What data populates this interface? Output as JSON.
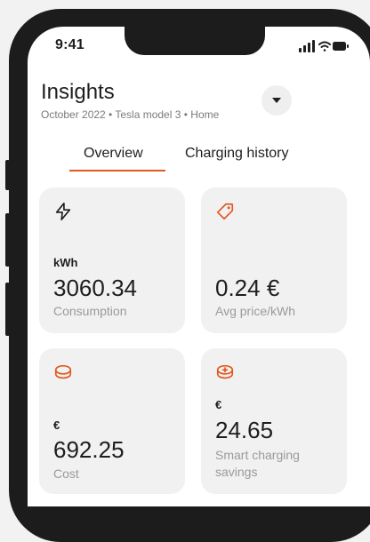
{
  "status_bar": {
    "time": "9:41"
  },
  "header": {
    "title": "Insights",
    "subtitle": "October 2022 • Tesla model 3 • Home"
  },
  "tabs": [
    {
      "label": "Overview"
    },
    {
      "label": "Charging history"
    }
  ],
  "cards": [
    {
      "icon": "lightning-icon",
      "unit": "kWh",
      "value": "3060.34",
      "label": "Consumption"
    },
    {
      "icon": "price-tag-icon",
      "unit": "",
      "value": "0.24 €",
      "label": "Avg price/kWh"
    },
    {
      "icon": "coins-icon",
      "unit": "€",
      "value": "692.25",
      "label": "Cost"
    },
    {
      "icon": "coin-plus-icon",
      "unit": "€",
      "value": "24.65",
      "label": "Smart charging savings"
    }
  ],
  "colors": {
    "accent": "#e2571e",
    "card_bg": "#f1f1f1",
    "text_muted": "#9a9a9a"
  }
}
